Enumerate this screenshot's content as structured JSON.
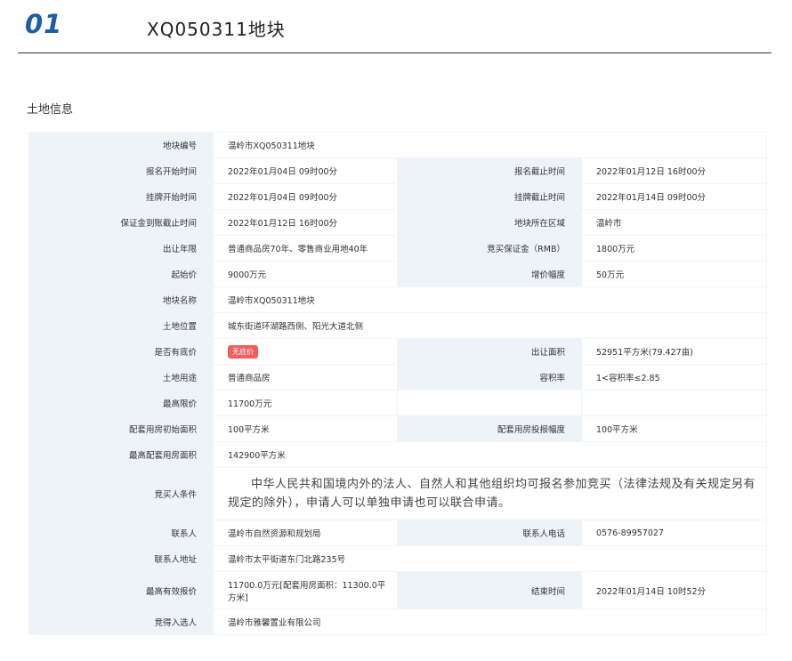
{
  "header": {
    "number": "01",
    "title": "XQ050311地块"
  },
  "section_title": "土地信息",
  "colors": {
    "accent": "#1a5ea8",
    "label_bg": "#eef3f9",
    "badge": "#ef5f5f"
  },
  "rows": {
    "plot_code": {
      "label": "地块编号",
      "value": "温岭市XQ050311地块"
    },
    "reg_start": {
      "label": "报名开始时间",
      "value": "2022年01月04日 09时00分"
    },
    "reg_end": {
      "label": "报名截止时间",
      "value": "2022年01月12日 16时00分"
    },
    "listing_start": {
      "label": "挂牌开始时间",
      "value": "2022年01月04日 09时00分"
    },
    "listing_end": {
      "label": "挂牌截止时间",
      "value": "2022年01月14日 09时00分"
    },
    "deposit_deadline": {
      "label": "保证金到账截止时间",
      "value": "2022年01月12日 16时00分"
    },
    "district": {
      "label": "地块所在区域",
      "value": "温岭市"
    },
    "term": {
      "label": "出让年限",
      "value": "普通商品房70年、零售商业用地40年"
    },
    "deposit": {
      "label": "竞买保证金（RMB）",
      "value": "1800万元"
    },
    "start_price": {
      "label": "起始价",
      "value": "9000万元"
    },
    "increment": {
      "label": "增价幅度",
      "value": "50万元"
    },
    "plot_name": {
      "label": "地块名称",
      "value": "温岭市XQ050311地块"
    },
    "location": {
      "label": "土地位置",
      "value": "城东街道环湖路西侧、阳光大道北侧"
    },
    "reserve": {
      "label": "是否有底价",
      "value": "无底价"
    },
    "area": {
      "label": "出让面积",
      "value": "52951平方米(79.427亩)"
    },
    "usage": {
      "label": "土地用途",
      "value": "普通商品房"
    },
    "far": {
      "label": "容积率",
      "value": "1<容积率≤2.85"
    },
    "max_price": {
      "label": "最高限价",
      "value": "11700万元"
    },
    "housing_initial": {
      "label": "配套用房初始面积",
      "value": "100平方米"
    },
    "housing_step": {
      "label": "配套用房投报幅度",
      "value": "100平方米"
    },
    "housing_max": {
      "label": "最高配套用房面积",
      "value": "142900平方米"
    },
    "conditions": {
      "label": "竞买人条件",
      "value": "中华人民共和国境内外的法人、自然人和其他组织均可报名参加竞买（法律法规及有关规定另有规定的除外），申请人可以单独申请也可以联合申请。"
    },
    "contact": {
      "label": "联系人",
      "value": "温岭市自然资源和规划局"
    },
    "phone": {
      "label": "联系人电话",
      "value": "0576-89957027"
    },
    "address": {
      "label": "联系人地址",
      "value": "温岭市太平街道东门北路235号"
    },
    "best_bid": {
      "label": "最高有效报价",
      "value": "11700.0万元[配套用房面积：11300.0平方米]"
    },
    "end_time": {
      "label": "结束时间",
      "value": "2022年01月14日 10时52分"
    },
    "winner": {
      "label": "竞得入选人",
      "value": "温岭市雅馨置业有限公司"
    }
  }
}
